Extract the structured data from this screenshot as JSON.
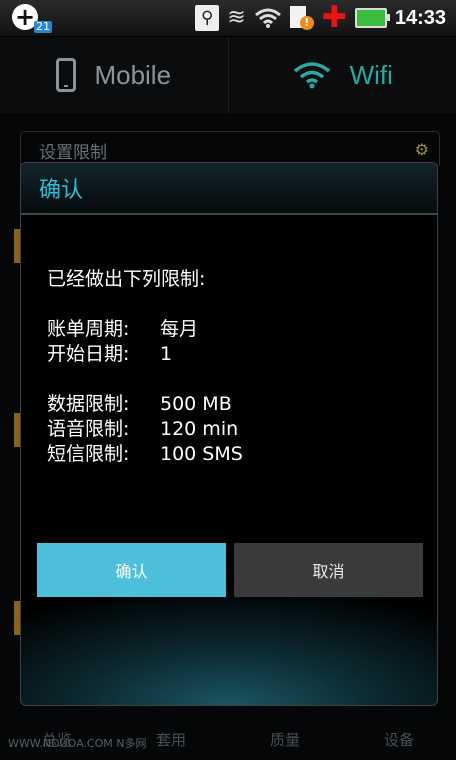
{
  "status_bar": {
    "notification_badge": "21",
    "time": "14:33",
    "icons": [
      "add-icon",
      "usb-icon",
      "sync-icon",
      "wifi-signal-icon",
      "alert-icon",
      "medical-cross-icon",
      "battery-charging-icon"
    ]
  },
  "tabs": [
    {
      "label": "Mobile",
      "icon": "phone-icon"
    },
    {
      "label": "Wifi",
      "icon": "wifi-icon"
    }
  ],
  "background": {
    "setting_title": "设置限制",
    "nav": [
      "总览",
      "套用",
      "质量",
      "设备"
    ],
    "watermark": "WWW.NDUOA.COM N多网"
  },
  "dialog": {
    "title": "确认",
    "intro": "已经做出下列限制:",
    "billing_cycle": {
      "label": "账单周期:",
      "value": "每月"
    },
    "start_date": {
      "label": "开始日期:",
      "value": "1"
    },
    "data_limit": {
      "label": "数据限制:",
      "value": "500 MB"
    },
    "voice_limit": {
      "label": "语音限制:",
      "value": "120 min"
    },
    "sms_limit": {
      "label": "短信限制:",
      "value": "100 SMS"
    },
    "confirm_label": "确认",
    "cancel_label": "取消"
  },
  "colors": {
    "accent": "#4cc0da",
    "title": "#2dbfd2",
    "wifi": "#2aa7a7"
  }
}
